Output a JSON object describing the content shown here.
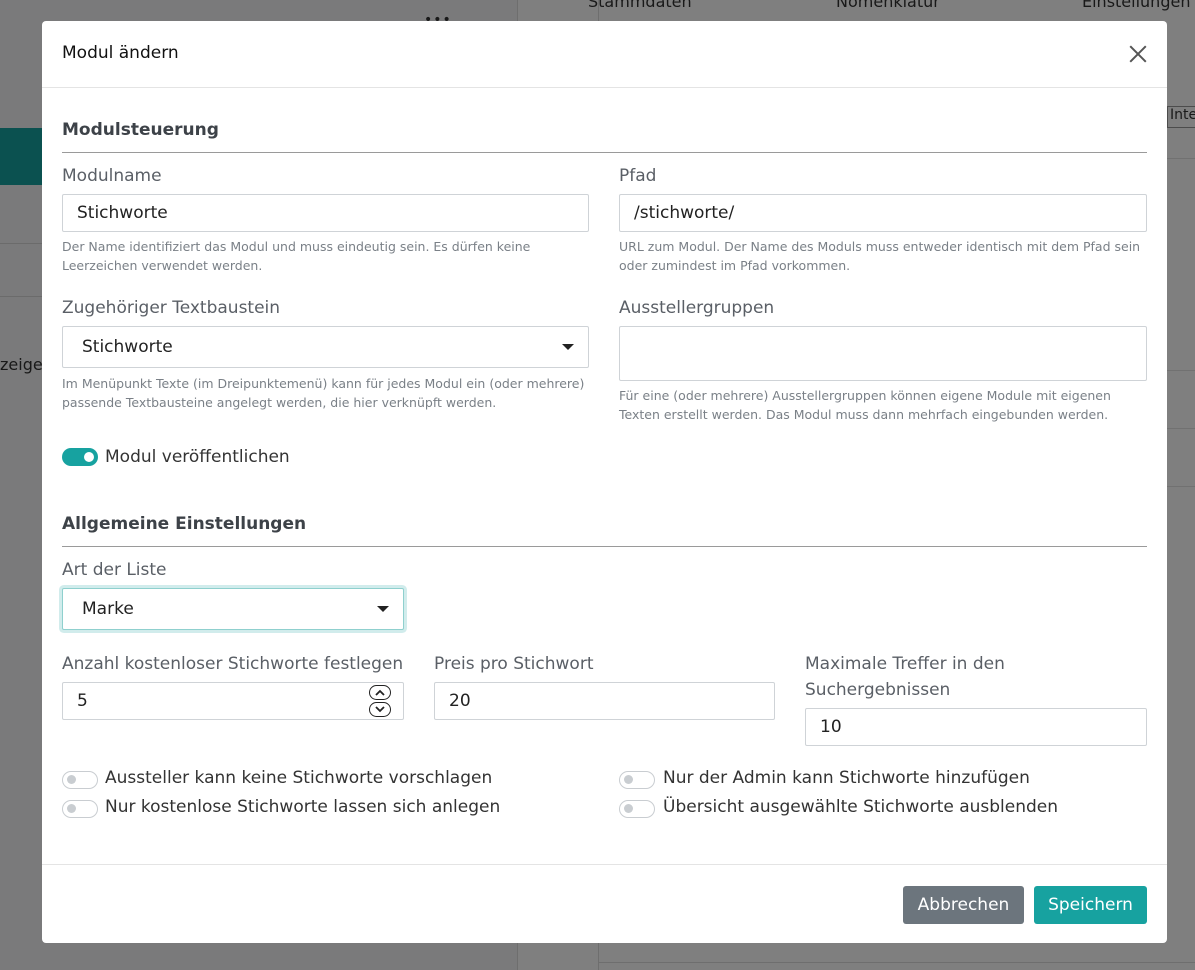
{
  "background": {
    "tabs": [
      "Stammdaten",
      "Nomenklatur",
      "Einstellungen"
    ],
    "left_text": "zeigen",
    "dots": "•••",
    "right_text": "Inter"
  },
  "modal": {
    "title": "Modul ändern",
    "section_module_control": "Modulsteuerung",
    "module_name": {
      "label": "Modulname",
      "value": "Stichworte",
      "help": "Der Name identifiziert das Modul und muss eindeutig sein. Es dürfen keine Leerzeichen verwendet werden."
    },
    "path": {
      "label": "Pfad",
      "value": "/stichworte/",
      "help": "URL zum Modul. Der Name des Moduls muss entweder identisch mit dem Pfad sein oder zumindest im Pfad vorkommen."
    },
    "text_module": {
      "label": "Zugehöriger Textbaustein",
      "value": "Stichworte",
      "help": "Im Menüpunkt Texte (im Dreipunktemenü) kann für jedes Modul ein (oder mehrere) passende Textbausteine angelegt werden, die hier verknüpft werden."
    },
    "exhibitor_groups": {
      "label": "Ausstellergruppen",
      "value": "",
      "help": "Für eine (oder mehrere) Ausstellergruppen können eigene Module mit eigenen Texten erstellt werden. Das Modul muss dann mehrfach eingebunden werden."
    },
    "publish_toggle": {
      "label": "Modul veröffentlichen",
      "checked": true
    },
    "section_general": "Allgemeine Einstellungen",
    "list_type": {
      "label": "Art der Liste",
      "value": "Marke"
    },
    "free_keywords": {
      "label": "Anzahl kostenloser Stichworte festlegen",
      "value": "5"
    },
    "price_per_keyword": {
      "label": "Preis pro Stichwort",
      "value": "20"
    },
    "max_hits": {
      "label": "Maximale Treffer in den Suchergebnissen",
      "value": "10"
    },
    "toggles": {
      "no_suggest": {
        "label": "Aussteller kann keine Stichworte vorschlagen",
        "checked": false
      },
      "admin_only": {
        "label": "Nur der Admin kann Stichworte hinzufügen",
        "checked": false
      },
      "free_only": {
        "label": "Nur kostenlose Stichworte lassen sich anlegen",
        "checked": false
      },
      "hide_overview": {
        "label": "Übersicht ausgewählte Stichworte ausblenden",
        "checked": false
      }
    },
    "cancel_label": "Abbrechen",
    "save_label": "Speichern"
  },
  "colors": {
    "accent": "#17a2a0",
    "secondary": "#6c757d"
  }
}
